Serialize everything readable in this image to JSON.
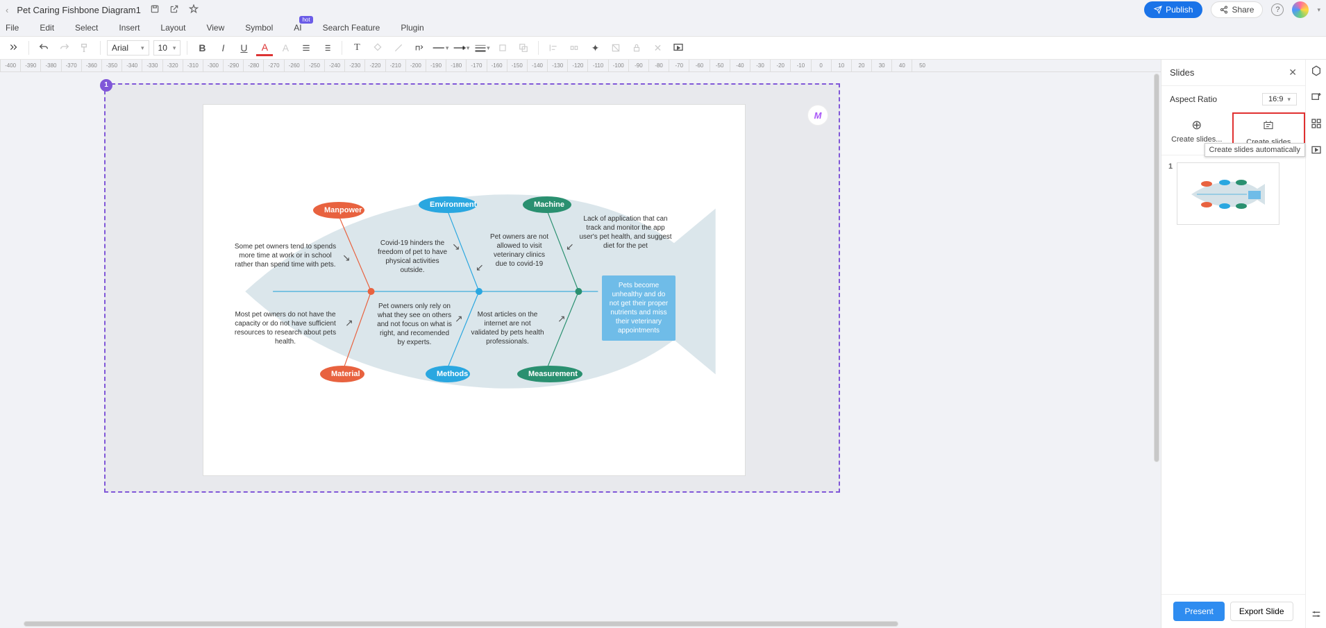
{
  "titlebar": {
    "doc_title": "Pet Caring Fishbone Diagram1",
    "publish": "Publish",
    "share": "Share"
  },
  "menu": {
    "file": "File",
    "edit": "Edit",
    "select": "Select",
    "insert": "Insert",
    "layout": "Layout",
    "view": "View",
    "symbol": "Symbol",
    "ai": "AI",
    "ai_badge": "hot",
    "search": "Search Feature",
    "plugin": "Plugin"
  },
  "toolbar": {
    "font": "Arial",
    "font_size": "10"
  },
  "ruler_ticks": [
    "-400",
    "-390",
    "-380",
    "-370",
    "-360",
    "-350",
    "-340",
    "-330",
    "-320",
    "-310",
    "-300",
    "-290",
    "-280",
    "-270",
    "-260",
    "-250",
    "-240",
    "-230",
    "-220",
    "-210",
    "-200",
    "-190",
    "-180",
    "-170",
    "-160",
    "-150",
    "-140",
    "-130",
    "-120",
    "-110",
    "-100",
    "-90",
    "-80",
    "-70",
    "-60",
    "-50",
    "-40",
    "-30",
    "-20",
    "-10",
    "0",
    "10",
    "20",
    "30",
    "40",
    "50"
  ],
  "page_number": "1",
  "fishbone": {
    "categories": {
      "manpower": "Manpower",
      "environment": "Environment",
      "machine": "Machine",
      "material": "Material",
      "methods": "Methods",
      "measurement": "Measurement"
    },
    "causes": {
      "manpower_c": "Some pet owners tend to spends more time at work or in school rather than spend time with pets.",
      "environment_c": "Covid-19 hinders the freedom of pet to have physical activities outside.",
      "machine_c1": "Pet owners are not allowed to visit veterinary clinics due to covid-19",
      "machine_c2": "Lack of application that can track and monitor the app user's pet health, and suggest diet for the pet",
      "material_c": "Most pet owners do not have the capacity or do not have sufficient resources to research about pets health.",
      "methods_c": "Pet owners only rely on what they see on others and not focus on what is right, and recomended by experts.",
      "measurement_c": "Most articles on the internet are not validated by pets health professionals."
    },
    "effect": "Pets become unhealthy and do not get their proper nutrients and miss their veterinary appointments"
  },
  "slides_panel": {
    "title": "Slides",
    "aspect_label": "Aspect Ratio",
    "aspect_value": "16:9",
    "create_slides": "Create slides...",
    "create_auto": "Create slides",
    "tooltip": "Create slides automatically",
    "thumb_num": "1",
    "present": "Present",
    "export": "Export Slide"
  }
}
